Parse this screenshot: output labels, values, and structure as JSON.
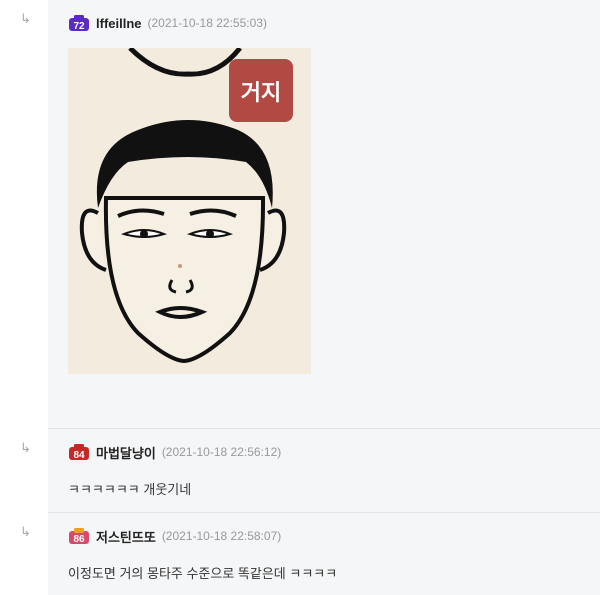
{
  "comments": [
    {
      "reply_icon": "↳",
      "level": "72",
      "level_color": "#5b2cc0",
      "nickname": "lffeillne",
      "timestamp": "(2021-10-18 22:55:03)",
      "image_tag": "거지"
    },
    {
      "reply_icon": "↳",
      "level": "84",
      "level_color": "#c62828",
      "nickname": "마법달냥이",
      "timestamp": "(2021-10-18 22:56:12)",
      "text": "ㅋㅋㅋㅋㅋㅋ 개웃기네"
    },
    {
      "reply_icon": "↳",
      "level": "86",
      "level_color": "#d84a6a",
      "nickname": "저스틴뜨또",
      "timestamp": "(2021-10-18 22:58:07)",
      "text": "이정도면 거의 몽타주 수준으로 똑같은데 ㅋㅋㅋㅋ"
    }
  ]
}
